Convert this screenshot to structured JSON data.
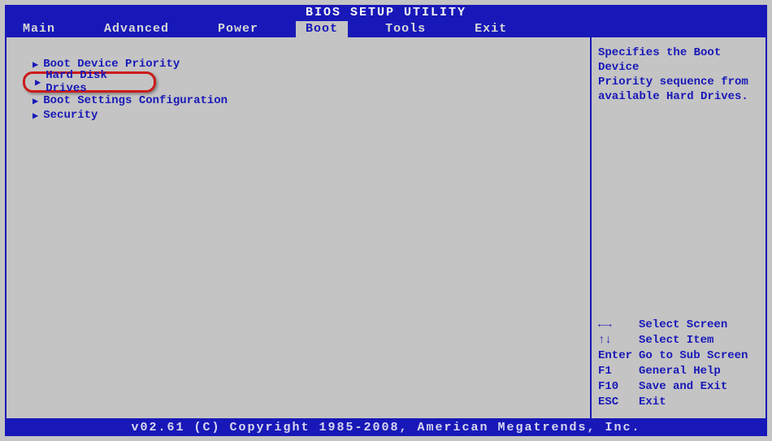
{
  "title": "BIOS SETUP UTILITY",
  "menu": {
    "items": [
      {
        "label": "Main"
      },
      {
        "label": "Advanced"
      },
      {
        "label": "Power"
      },
      {
        "label": "Boot"
      },
      {
        "label": "Tools"
      },
      {
        "label": "Exit"
      }
    ]
  },
  "boot": {
    "items": [
      {
        "label": "Boot Device Priority"
      },
      {
        "label": "Hard Disk Drives"
      },
      {
        "label": "Boot Settings Configuration"
      },
      {
        "label": "Security"
      }
    ]
  },
  "help": {
    "line1": "Specifies the Boot Device",
    "line2": "Priority sequence from",
    "line3": "available Hard Drives."
  },
  "keys": {
    "r1": {
      "k": "←→",
      "d": "Select Screen"
    },
    "r2": {
      "k": "↑↓",
      "d": "Select Item"
    },
    "r3": {
      "k": "Enter",
      "d": "Go to Sub Screen"
    },
    "r4": {
      "k": "F1",
      "d": "General Help"
    },
    "r5": {
      "k": "F10",
      "d": "Save and Exit"
    },
    "r6": {
      "k": "ESC",
      "d": "Exit"
    }
  },
  "footer": "v02.61 (C) Copyright 1985-2008, American Megatrends, Inc."
}
